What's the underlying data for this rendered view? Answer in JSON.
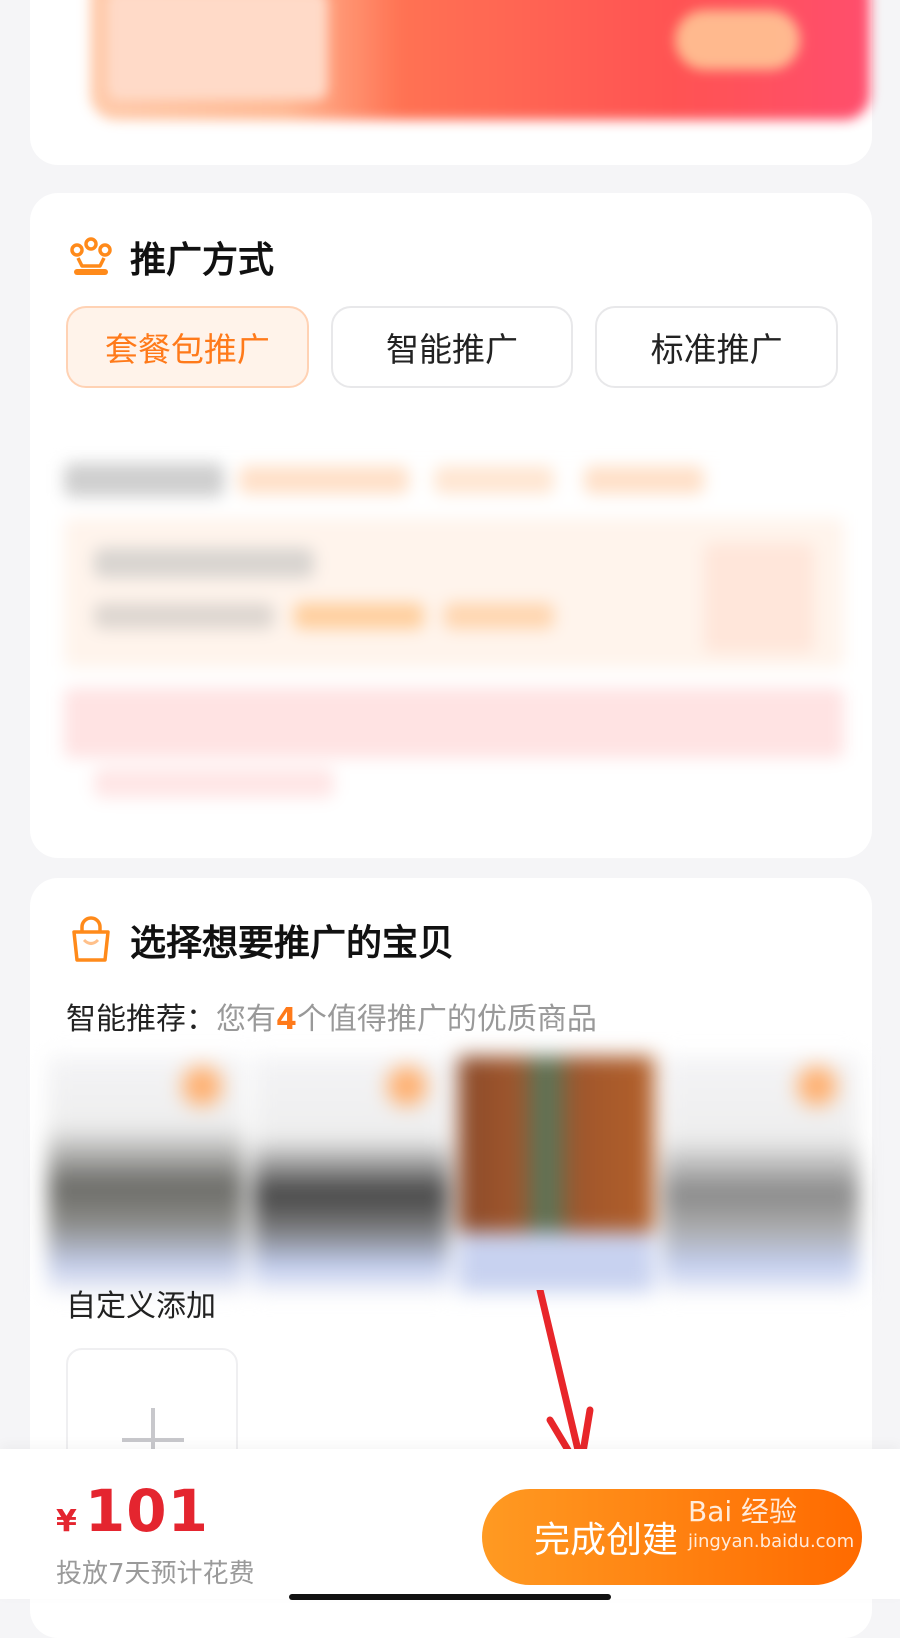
{
  "promotion": {
    "title": "推广方式",
    "options": [
      {
        "label": "套餐包推广",
        "active": true
      },
      {
        "label": "智能推广",
        "active": false
      },
      {
        "label": "标准推广",
        "active": false
      }
    ]
  },
  "products": {
    "title": "选择想要推广的宝贝",
    "recommend_label": "智能推荐：",
    "recommend_prefix": "您有",
    "recommend_count": "4",
    "recommend_suffix": "个值得推广的优质商品",
    "custom_add_label": "自定义添加"
  },
  "bottom": {
    "currency": "¥",
    "price": "101",
    "note": "投放7天预计花费",
    "cta_label": "完成创建",
    "watermark_main": "Bai 经验",
    "watermark_sub": "jingyan.baidu.com"
  },
  "colors": {
    "accent": "#ff7a1a",
    "price_red": "#e4252f",
    "cta_start": "#ff9a22",
    "cta_end": "#ff6a00"
  }
}
